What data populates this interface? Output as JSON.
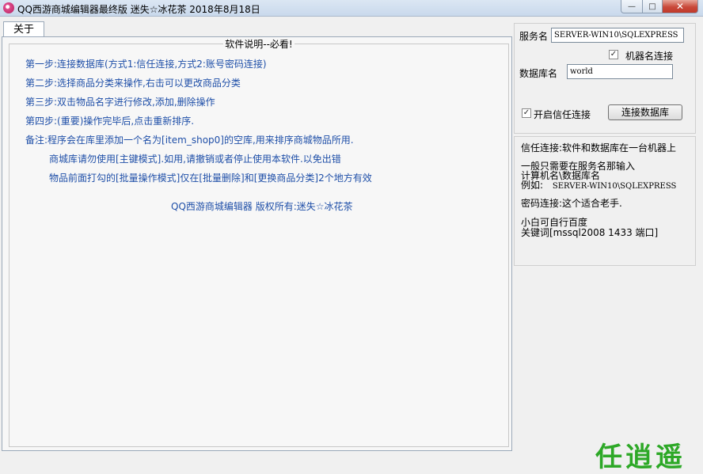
{
  "window": {
    "title": "QQ西游商城编辑器最终版  迷失☆冰花茶  2018年8月18日",
    "minimize_glyph": "—",
    "maximize_glyph": "□",
    "close_glyph": "✕"
  },
  "tabs": [
    {
      "label": "关于",
      "active": true
    }
  ],
  "about": {
    "group_title": "软件说明--必看!",
    "lines": [
      "第一步:连接数据库(方式1:信任连接,方式2:账号密码连接)",
      "第二步:选择商品分类来操作,右击可以更改商品分类",
      "第三步:双击物品名字进行修改,添加,删除操作",
      "第四步:(重要)操作完毕后,点击重新排序.",
      "备注:程序会在库里添加一个名为[item_shop0]的空库,用来排序商城物品所用.",
      "商城库请勿使用[主键模式].如用,请撤销或者停止使用本软件.以免出错",
      "物品前面打勾的[批量操作模式]仅在[批量删除]和[更换商品分类]2个地方有效"
    ],
    "copyright": "QQ西游商城编辑器   版权所有:迷失☆冰花茶"
  },
  "connection": {
    "server_label": "服务名",
    "server_value": "SERVER-WIN10\\SQLEXPRESS",
    "machine_name_checkbox_label": "机器名连接",
    "machine_name_checked": true,
    "database_label": "数据库名",
    "database_value": "world",
    "trusted_checkbox_label": "开启信任连接",
    "trusted_checked": true,
    "connect_button": "连接数据库",
    "check_glyph": "✓"
  },
  "help": {
    "line1": "信任连接:软件和数据库在一台机器上",
    "line2": "一般只需要在服务名那输入",
    "line3": "计算机名\\数据库名",
    "line4_prefix": "例如:",
    "line4_value": "SERVER-WIN10\\SQLEXPRESS",
    "line5": "密码连接:这个适合老手.",
    "line6": "小白可自行百度",
    "line7": "关键词[mssql2008 1433 端口]"
  },
  "watermark": "任逍遥",
  "colors": {
    "instruction_text": "#1f4fa8",
    "watermark": "#2da827",
    "close_button": "#c9493a"
  }
}
